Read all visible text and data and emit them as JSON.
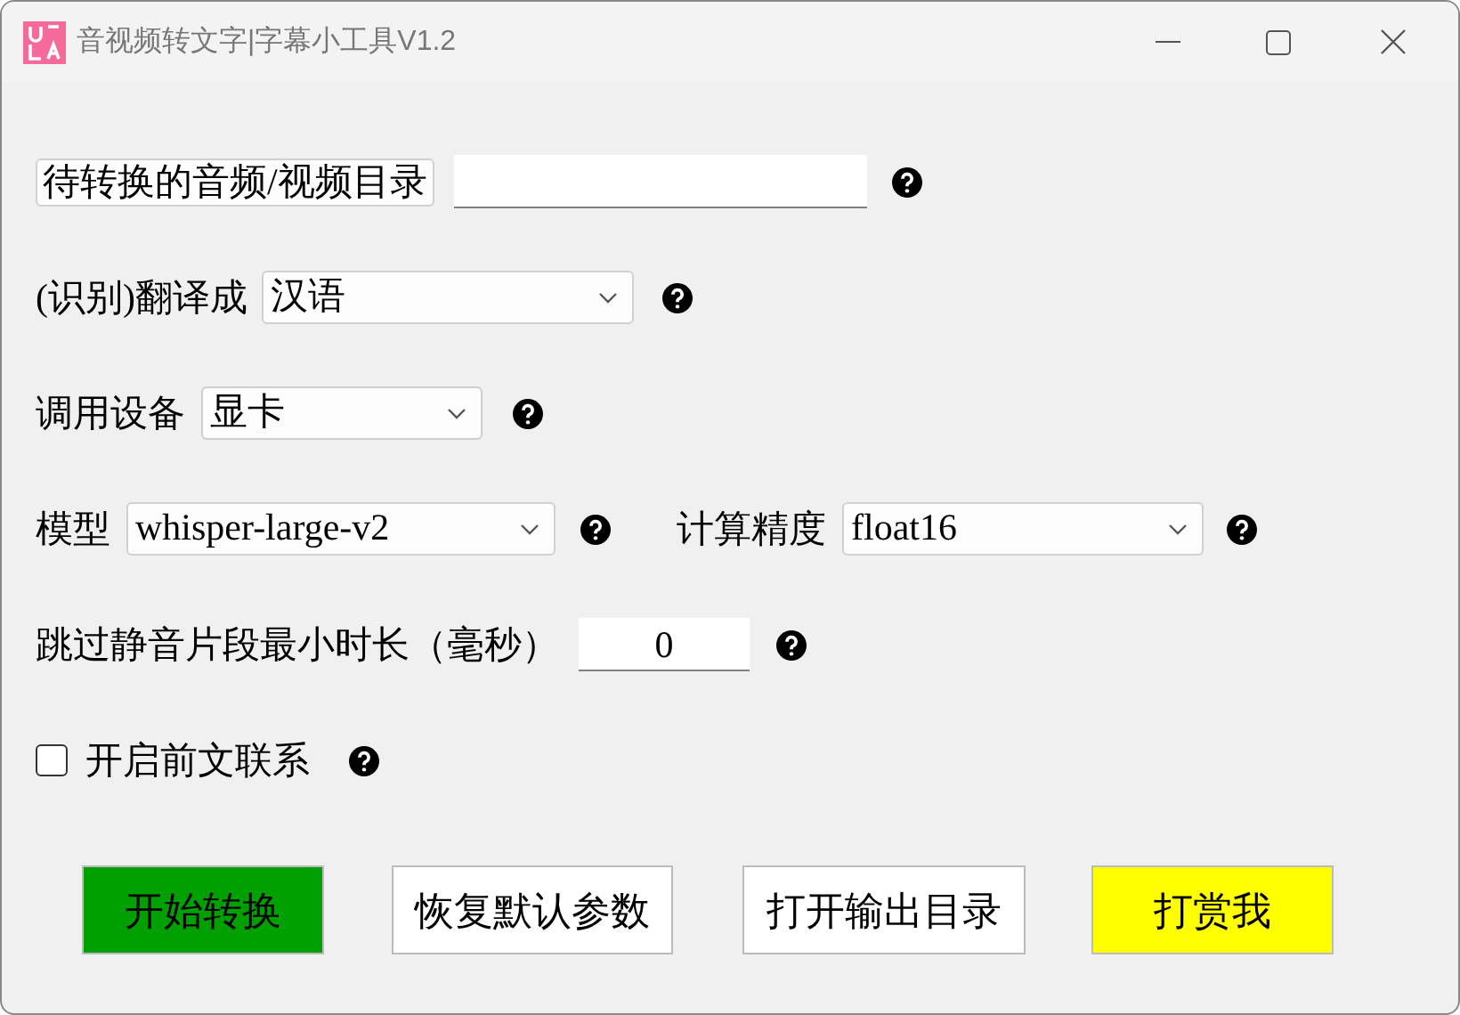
{
  "window": {
    "title": "音视频转文字|字幕小工具V1.2"
  },
  "rows": [
    {
      "items": [
        {
          "kind": "label_button",
          "text": "待转换的音频/视频目录"
        },
        {
          "kind": "input"
        },
        {
          "kind": "help"
        }
      ]
    },
    {
      "items": [
        {
          "kind": "label",
          "text": "(识别)翻译成"
        },
        {
          "kind": "select",
          "value": "汉语"
        },
        {
          "kind": "help"
        }
      ]
    },
    {
      "items": [
        {
          "kind": "label",
          "text": "调用设备"
        },
        {
          "kind": "select",
          "value": "显卡"
        },
        {
          "kind": "help"
        }
      ]
    },
    {
      "items": [
        {
          "kind": "label",
          "text": "模型"
        },
        {
          "kind": "select",
          "value": "whisper-large-v2"
        },
        {
          "kind": "help"
        },
        {
          "kind": "label",
          "text": "计算精度"
        },
        {
          "kind": "select",
          "value": "float16"
        },
        {
          "kind": "help"
        }
      ]
    },
    {
      "items": [
        {
          "kind": "label",
          "text": "跳过静音片段最小时长（毫秒）"
        },
        {
          "kind": "input",
          "value": "0"
        },
        {
          "kind": "help"
        }
      ]
    },
    {
      "items": [
        {
          "kind": "checkbox",
          "checked": false
        },
        {
          "kind": "label",
          "text": "开启前文联系"
        },
        {
          "kind": "help"
        }
      ]
    }
  ],
  "buttons": [
    {
      "label": "开始转换",
      "color": "#00a000"
    },
    {
      "label": "恢复默认参数",
      "color": "#ffffff"
    },
    {
      "label": "打开输出目录",
      "color": "#ffffff"
    },
    {
      "label": "打赏我",
      "color": "#ffff00"
    }
  ]
}
